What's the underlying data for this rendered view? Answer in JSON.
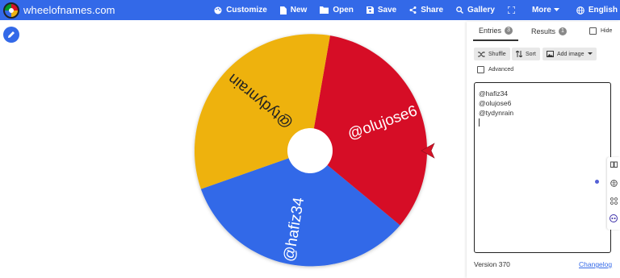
{
  "brand": {
    "name": "wheelofnames.com"
  },
  "nav": [
    {
      "key": "customize",
      "label": "Customize",
      "icon": "palette-icon"
    },
    {
      "key": "new",
      "label": "New",
      "icon": "file-icon"
    },
    {
      "key": "open",
      "label": "Open",
      "icon": "folder-icon"
    },
    {
      "key": "save",
      "label": "Save",
      "icon": "floppy-icon"
    },
    {
      "key": "share",
      "label": "Share",
      "icon": "share-icon"
    },
    {
      "key": "gallery",
      "label": "Gallery",
      "icon": "search-icon"
    },
    {
      "key": "fullscreen",
      "label": "",
      "icon": "fullscreen-icon"
    },
    {
      "key": "more",
      "label": "More",
      "icon": "chevron-down-icon"
    },
    {
      "key": "language",
      "label": "English",
      "icon": "globe-icon"
    }
  ],
  "wheel": {
    "segments": [
      {
        "label": "@hafiz34",
        "color": "#3369e8"
      },
      {
        "label": "@olujose6",
        "color": "#d61126"
      },
      {
        "label": "@tydynrain",
        "color": "#eeb211"
      }
    ],
    "pointer_color": "#d61126"
  },
  "panel": {
    "tabs": {
      "entries": {
        "label": "Entries",
        "count": "3"
      },
      "results": {
        "label": "Results",
        "count": "1"
      }
    },
    "hide_label": "Hide",
    "buttons": {
      "shuffle": "Shuffle",
      "sort": "Sort",
      "add_image": "Add image"
    },
    "advanced_label": "Advanced",
    "entries_text": [
      "@hafiz34",
      "@olujose6",
      "@tydynrain"
    ],
    "version": "Version 370",
    "changelog": "Changelog"
  },
  "colors": {
    "topbar": "#3369e8",
    "link": "#3369e8"
  }
}
